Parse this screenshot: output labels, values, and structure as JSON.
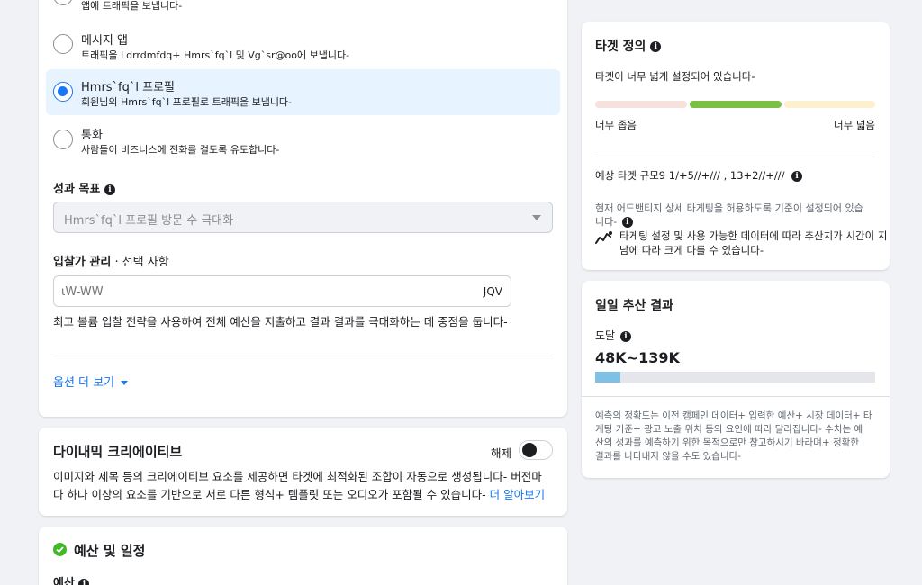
{
  "objective": {
    "options": [
      {
        "title": "",
        "desc": "앱에 트래픽을 보냅니다-",
        "selected": false
      },
      {
        "title": "메시지 앱",
        "desc": "트래픽을 Ldrrdmfdq+ Hmrs`fq`l 및 Vg`sr@oo에 보냅니다-",
        "selected": false
      },
      {
        "title": "Hmrs`fq`l 프로필",
        "desc": "회원님의 Hmrs`fq`l 프로필로 트래픽을 보냅니다-",
        "selected": true
      },
      {
        "title": "통화",
        "desc": "사람들이 비즈니스에 전화를 걸도록 유도합니다-",
        "selected": false
      }
    ]
  },
  "performance_goal": {
    "label": "성과 목표",
    "value": "Hmrs`fq`l 프로필 방문 수 극대화"
  },
  "bid": {
    "label": "입찰가 관리",
    "optional": " · 선택 사항",
    "placeholder": "ιW-WW",
    "currency": "JQV",
    "help": "최고 볼륨 입찰 전략을 사용하여 전체 예산을 지출하고 결과 결과를 극대화하는 데 중점을 둡니다-"
  },
  "more_options": "옵션 더 보기",
  "dynamic_creative": {
    "title": "다이내믹 크리에이티브",
    "toggle_label": "해제",
    "toggle_on": false,
    "desc_line1": "이미지와 제목 등의 크리에이티브 요소를 제공하면 타겟에 최적화된 조합이 자동으로 생성됩니다- 버전마",
    "desc_line2": "다 하나 이상의 요소를 기반으로 서로 다른 형식+ 템플릿 또는 오디오가 포함될 수 있습니다-",
    "learn_more": "더 알아보기"
  },
  "budget": {
    "title": "예산 및 일정",
    "sub_label": "예산"
  },
  "audience": {
    "title": "타겟 정의",
    "status": "타겟이 너무 넓게 설정되어 있습니다-",
    "narrow": "너무 좁음",
    "broad": "너무 넓음",
    "size_label": "예상 타겟 규모9 1/+5//+/// , 13+2//+///",
    "note_line1": "현재 어드밴티지 상세 타게팅을 허용하도록 기준이 설정되어 있습",
    "note_line2": "니다-",
    "warn_line1": "타게팅 설정 및 사용 가능한 데이터에 따라 추산치가 시간이 지",
    "warn_line2": "남에 따라 크게 다를 수 있습니다-"
  },
  "daily": {
    "title": "일일 추산 결과",
    "reach_label": "도달",
    "reach_value": "48K~139K",
    "reach_bar_fraction": 0.09,
    "disclaimer": [
      "예측의 정확도는 이전 캠페인 데이터+ 입력한 예산+ 시장 데이터+ 타",
      "게팅 기준+ 광고 노출 위치 등의 요인에 따라 달라집니다- 수치는 예",
      "산의 성과를 예측하기 위한 목적으로만 참고하시기 바라며+ 정확한",
      "결과를 나타내지 않을 수도 있습니다-"
    ]
  },
  "colors": {
    "accent": "#1877f2",
    "selected_bg": "#e7f3ff",
    "meter_green": "#7ac043",
    "meter_red": "#f7e1dc",
    "meter_yellow": "#fdf0cf",
    "reach_bar": "#7ec0e6",
    "success": "#42b72a"
  }
}
